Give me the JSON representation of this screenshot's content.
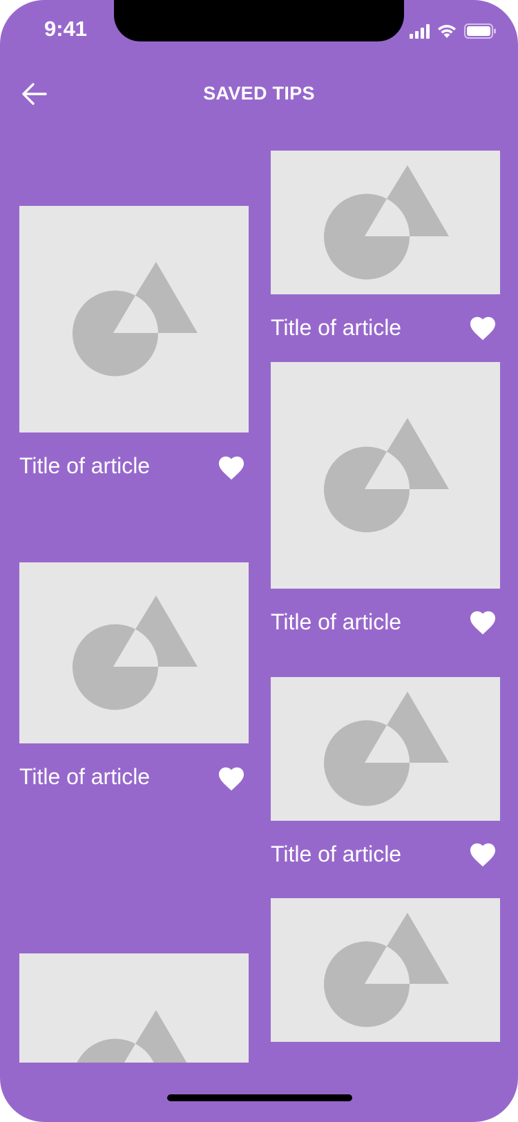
{
  "status_bar": {
    "time": "9:41"
  },
  "header": {
    "title": "SAVED TIPS",
    "back_icon": "arrow-left-icon"
  },
  "colors": {
    "background": "#9768cc",
    "card_placeholder": "#e6e6e6",
    "shape": "#b9b9b9",
    "text": "#ffffff"
  },
  "articles": [
    {
      "title": "Title of article",
      "saved": true
    },
    {
      "title": "Title of article",
      "saved": true
    },
    {
      "title": "Title of article",
      "saved": true
    },
    {
      "title": "Title of article",
      "saved": true
    },
    {
      "title": "Title of article",
      "saved": true
    },
    {
      "title": "",
      "saved": true
    },
    {
      "title": "",
      "saved": true
    }
  ]
}
